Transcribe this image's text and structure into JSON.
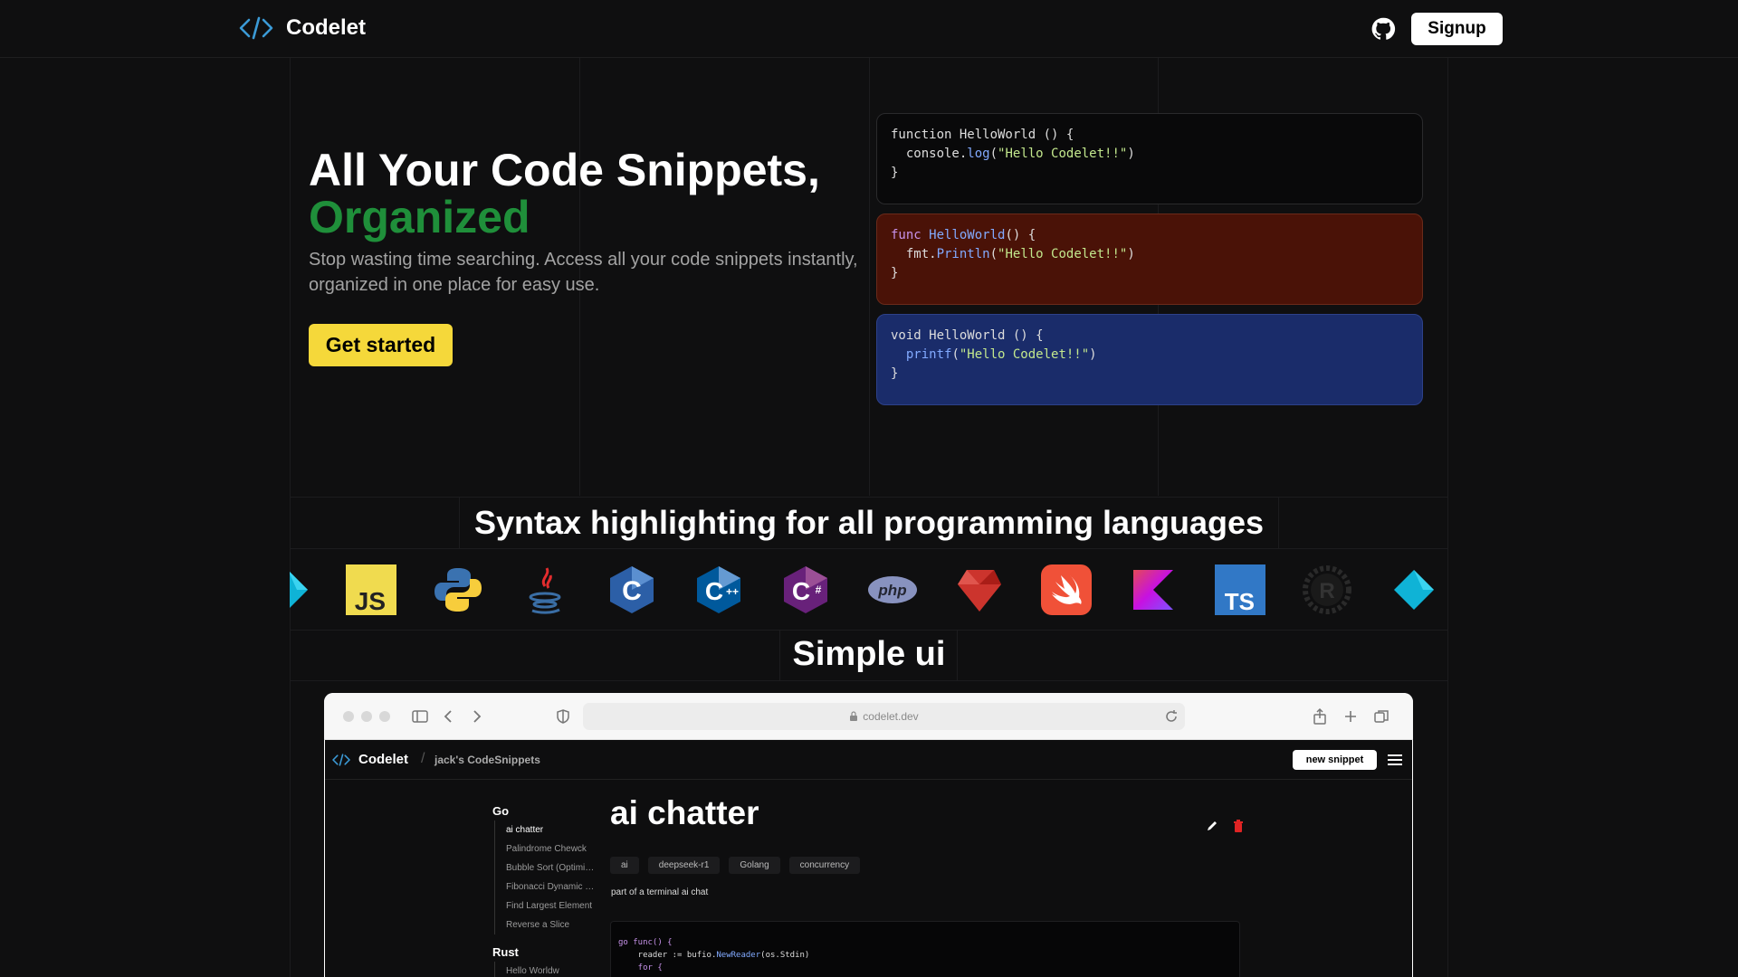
{
  "header": {
    "brand": "Codelet",
    "signup_label": "Signup"
  },
  "hero": {
    "title_line1": "All Your Code Snippets,",
    "title_line2": "Organized",
    "subtitle": "Stop wasting time searching. Access all your code snippets instantly, organized in one place for easy use.",
    "cta_label": "Get started",
    "accent_color": "#1f8f3a",
    "cta_color": "#f5d83a"
  },
  "code_cards": [
    {
      "line1_a": "function HelloWorld () {",
      "line2_a": "  console.",
      "line2_b": "log",
      "line2_c": "(",
      "line2_d": "\"Hello Codelet!!\"",
      "line2_e": ")",
      "line3": "}",
      "bg": "#09090a"
    },
    {
      "line1_a": "func ",
      "line1_b": "HelloWorld",
      "line1_c": "() {",
      "line2_a": "  fmt.",
      "line2_b": "Println",
      "line2_c": "(",
      "line2_d": "\"Hello Codelet!!\"",
      "line2_e": ")",
      "line3": "}",
      "bg": "#4a1207"
    },
    {
      "line1_a": "void HelloWorld () {",
      "line2_a": "  ",
      "line2_b": "printf",
      "line2_c": "(",
      "line2_d": "\"Hello Codelet!!\"",
      "line2_e": ")",
      "line3": "}",
      "bg": "#1a2c6a"
    }
  ],
  "syntax": {
    "title": "Syntax highlighting for all programming languages",
    "languages": [
      "dart-icon",
      "javascript-icon",
      "python-icon",
      "java-icon",
      "c-icon",
      "cpp-icon",
      "csharp-icon",
      "php-icon",
      "ruby-icon",
      "swift-icon",
      "kotlin-icon",
      "typescript-icon",
      "rust-icon",
      "dart-icon"
    ]
  },
  "simple_ui": {
    "title": "Simple ui",
    "browser": {
      "url": "codelet.dev",
      "app_name": "Codelet",
      "crumb": "jack's CodeSnippets",
      "new_snippet_label": "new snippet",
      "sidebar": {
        "group1": "Go",
        "group1_items": [
          "ai chatter",
          "Palindrome Chewck",
          "Bubble Sort (Optimized)",
          "Fibonacci Dynamic Programming",
          "Find Largest Element",
          "Reverse a Slice"
        ],
        "group2": "Rust",
        "group2_items": [
          "Hello Worldw"
        ]
      },
      "snippet": {
        "title": "ai chatter",
        "tags": [
          "ai",
          "deepseek-r1",
          "Golang",
          "concurrency"
        ],
        "description": "part of a terminal ai chat",
        "code_line1": "go func() {",
        "code_line2_a": "    reader := bufio.",
        "code_line2_b": "NewReader",
        "code_line2_c": "(os.Stdin)",
        "code_line3": "    for {"
      }
    }
  }
}
